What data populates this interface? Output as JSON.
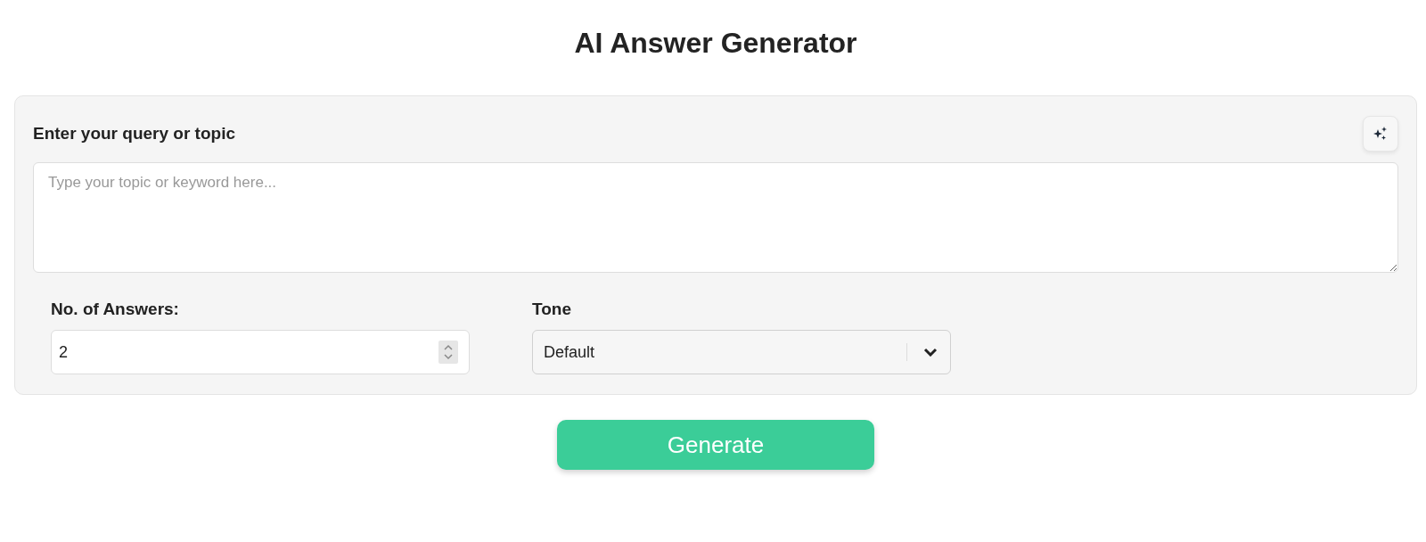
{
  "title": "AI Answer Generator",
  "query": {
    "label": "Enter your query or topic",
    "placeholder": "Type your topic or keyword here..."
  },
  "answers": {
    "label": "No. of Answers:",
    "value": "2"
  },
  "tone": {
    "label": "Tone",
    "value": "Default"
  },
  "generate_button": "Generate"
}
